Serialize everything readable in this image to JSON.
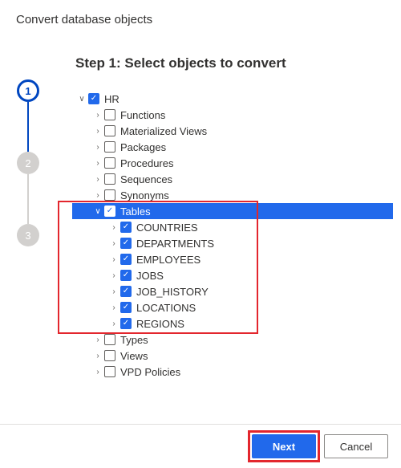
{
  "dialog": {
    "title": "Convert database objects"
  },
  "stepper": {
    "steps": [
      "1",
      "2",
      "3"
    ],
    "active_index": 0
  },
  "heading": "Step 1: Select objects to convert",
  "tree": {
    "root": {
      "label": "HR",
      "checked": true
    },
    "children": [
      {
        "label": "Functions",
        "checked": false
      },
      {
        "label": "Materialized Views",
        "checked": false
      },
      {
        "label": "Packages",
        "checked": false
      },
      {
        "label": "Procedures",
        "checked": false
      },
      {
        "label": "Sequences",
        "checked": false
      },
      {
        "label": "Synonyms",
        "checked": false
      }
    ],
    "tables_node": {
      "label": "Tables",
      "checked": true,
      "selected": true
    },
    "tables": [
      {
        "label": "COUNTRIES",
        "checked": true
      },
      {
        "label": "DEPARTMENTS",
        "checked": true
      },
      {
        "label": "EMPLOYEES",
        "checked": true
      },
      {
        "label": "JOBS",
        "checked": true
      },
      {
        "label": "JOB_HISTORY",
        "checked": true
      },
      {
        "label": "LOCATIONS",
        "checked": true
      },
      {
        "label": "REGIONS",
        "checked": true
      }
    ],
    "after": [
      {
        "label": "Types",
        "checked": false
      },
      {
        "label": "Views",
        "checked": false
      },
      {
        "label": "VPD Policies",
        "checked": false
      }
    ]
  },
  "footer": {
    "next": "Next",
    "cancel": "Cancel"
  }
}
